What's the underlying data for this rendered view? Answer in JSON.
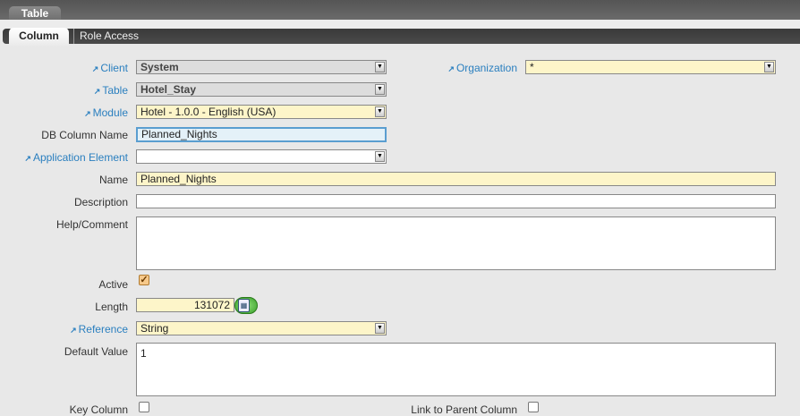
{
  "window_tab": "Table",
  "tabs": [
    "Column",
    "Role Access"
  ],
  "form": {
    "client": {
      "label": "Client",
      "value": "System"
    },
    "organization": {
      "label": "Organization",
      "value": "*"
    },
    "table": {
      "label": "Table",
      "value": "Hotel_Stay"
    },
    "module": {
      "label": "Module",
      "value": "Hotel - 1.0.0 - English (USA)"
    },
    "db_column_name": {
      "label": "DB Column Name",
      "value": "Planned_Nights"
    },
    "application_element": {
      "label": "Application Element",
      "value": ""
    },
    "name": {
      "label": "Name",
      "value": "Planned_Nights"
    },
    "description": {
      "label": "Description",
      "value": ""
    },
    "help_comment": {
      "label": "Help/Comment",
      "value": ""
    },
    "active": {
      "label": "Active",
      "checked": true
    },
    "length": {
      "label": "Length",
      "value": "131072"
    },
    "reference": {
      "label": "Reference",
      "value": "String"
    },
    "default_value": {
      "label": "Default Value",
      "value": "1"
    },
    "key_column": {
      "label": "Key Column",
      "checked": false
    },
    "link_parent_column": {
      "label": "Link to Parent Column",
      "checked": false
    }
  }
}
